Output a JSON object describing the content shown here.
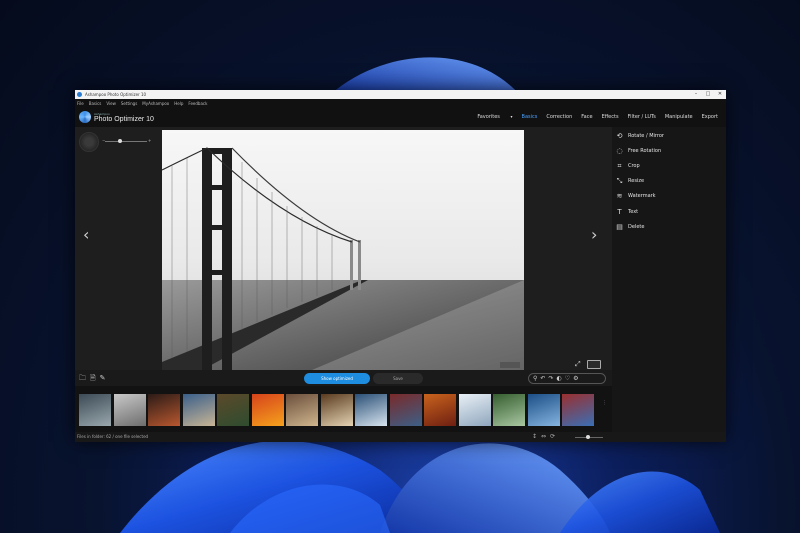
{
  "window": {
    "title": "Ashampoo Photo Optimizer 10",
    "controls": [
      "–",
      "□",
      "✕"
    ]
  },
  "menu": [
    "File",
    "Basics",
    "View",
    "Settings",
    "MyAshampoo",
    "Help",
    "Feedback"
  ],
  "brand": {
    "subtitle": "Ashampoo",
    "name": "Photo Optimizer 10"
  },
  "tabs": [
    {
      "label": "Favorites",
      "caret": "▾"
    },
    {
      "label": "Basics",
      "active": true
    },
    {
      "label": "Correction"
    },
    {
      "label": "Face"
    },
    {
      "label": "Effects"
    },
    {
      "label": "Filter / LUTs"
    },
    {
      "label": "Manipulate"
    },
    {
      "label": "Export"
    }
  ],
  "zoom": {
    "minus": "−",
    "plus": "+",
    "level": 0.35
  },
  "nav": {
    "prev": "‹",
    "next": "›"
  },
  "tools": [
    {
      "label": "Rotate / Mirror",
      "icon": "rotate-icon"
    },
    {
      "label": "Free Rotation",
      "icon": "free-rotation-icon"
    },
    {
      "label": "Crop",
      "icon": "crop-icon"
    },
    {
      "label": "Resize",
      "icon": "resize-icon"
    },
    {
      "label": "Watermark",
      "icon": "watermark-icon"
    },
    {
      "label": "Text",
      "icon": "text-icon"
    },
    {
      "label": "Delete",
      "icon": "delete-icon"
    }
  ],
  "bottom": {
    "show_optimized": "Show optimized",
    "save": "Save"
  },
  "status": {
    "text": "Files in folder: 62 / one file selected"
  },
  "thumb_colors": [
    [
      "#3b4a55",
      "#9aa7ad"
    ],
    [
      "#c9c9c9",
      "#6d6d6d"
    ],
    [
      "#2c1b17",
      "#b9582f"
    ],
    [
      "#3a5f8a",
      "#c8b596"
    ],
    [
      "#5b4a2a",
      "#2f4c2f"
    ],
    [
      "#d6431b",
      "#f6a21d"
    ],
    [
      "#6b4f3c",
      "#cfb68d"
    ],
    [
      "#5a3a1f",
      "#e4d3b3"
    ],
    [
      "#2a4f76",
      "#d7e4ef"
    ],
    [
      "#7a2a2a",
      "#3c5f87"
    ],
    [
      "#c9631d",
      "#6e1f12"
    ],
    [
      "#e9f0f6",
      "#8fa6bd"
    ],
    [
      "#355e2f",
      "#a9c7a2"
    ],
    [
      "#1c4e86",
      "#85b4e0"
    ],
    [
      "#9a2f2f",
      "#3a6fb5"
    ]
  ]
}
